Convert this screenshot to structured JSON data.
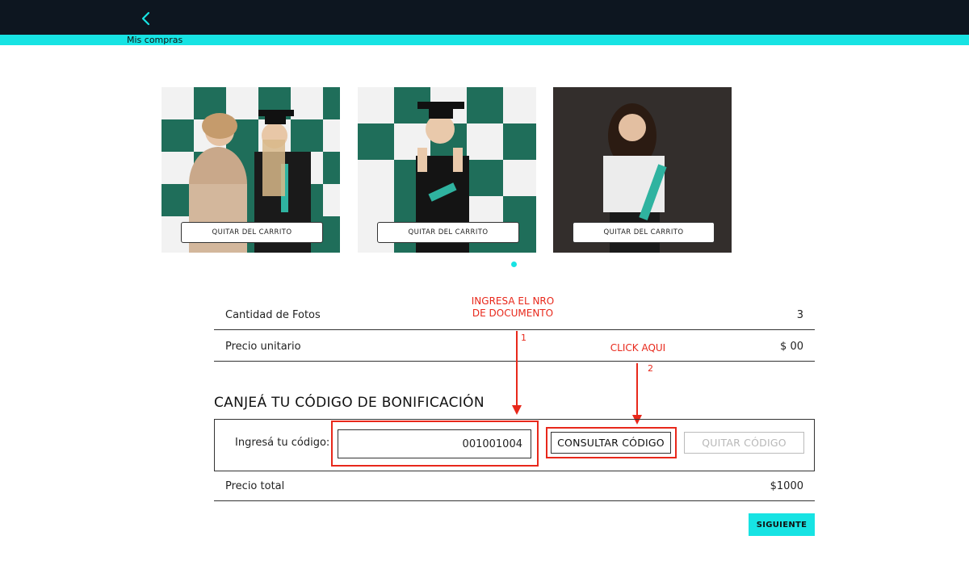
{
  "header": {
    "back_icon": "chevron-left-icon",
    "breadcrumb": "Mis compras",
    "colors": {
      "bar": "#0d1620",
      "accent": "#17e3e3"
    }
  },
  "cart": {
    "photos": [
      {
        "remove_label": "QUITAR DEL CARRITO"
      },
      {
        "remove_label": "QUITAR DEL CARRITO"
      },
      {
        "remove_label": "QUITAR DEL CARRITO"
      }
    ]
  },
  "summary": {
    "photo_count_label": "Cantidad de Fotos",
    "photo_count_value": "3",
    "unit_price_label": "Precio unitario",
    "unit_price_value": "$ 00",
    "total_label": "Precio total",
    "total_value": "$1000"
  },
  "coupon": {
    "title": "CANJEÁ TU CÓDIGO DE BONIFICACIÓN",
    "input_label": "Ingresá tu código:",
    "input_value": "001001004",
    "consult_label": "CONSULTAR CÓDIGO",
    "remove_label": "QUITAR CÓDIGO"
  },
  "annotations": {
    "step1_text": "INGRESA EL NRO\nDE DOCUMENTO",
    "step1_line1": "INGRESA EL NRO",
    "step1_line2": "DE DOCUMENTO",
    "step1_num": "1",
    "step2_text": "CLICK AQUI",
    "step2_num": "2",
    "color": "#e8281b"
  },
  "actions": {
    "next_label": "SIGUIENTE"
  }
}
